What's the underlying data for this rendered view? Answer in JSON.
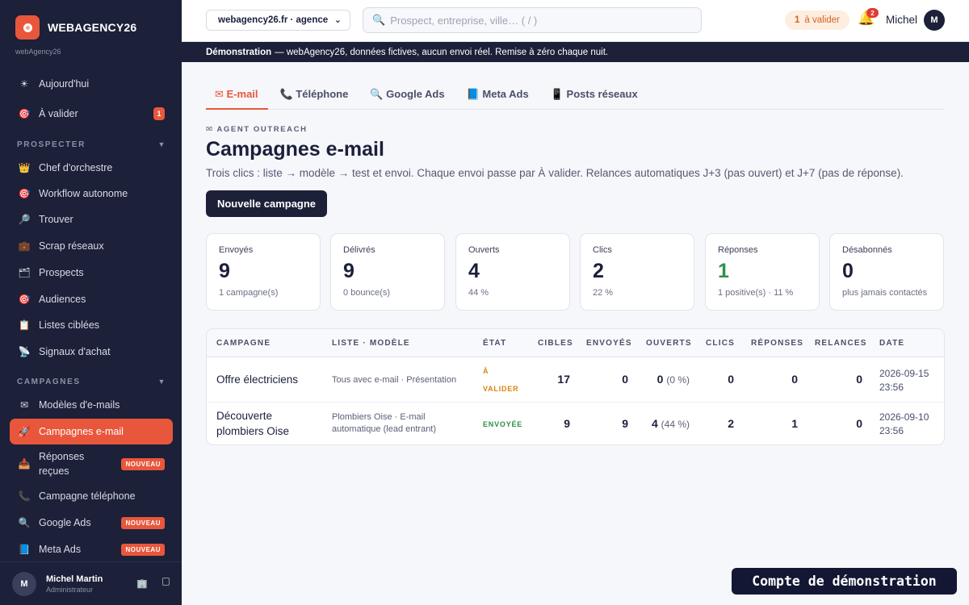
{
  "brand": {
    "name": "WEBAGENCY26",
    "sub": "webAgency26"
  },
  "sidebar": {
    "top_items": [
      {
        "label": "Aujourd'hui",
        "icon": "sun-icon"
      },
      {
        "label": "À valider",
        "icon": "target-icon",
        "badge": "1"
      }
    ],
    "sections": [
      {
        "title": "PROSPECTER",
        "items": [
          {
            "label": "Chef d'orchestre",
            "icon": "crown-icon"
          },
          {
            "label": "Workflow autonome",
            "icon": "target-icon"
          },
          {
            "label": "Trouver",
            "icon": "magnifier-icon"
          },
          {
            "label": "Scrap réseaux",
            "icon": "briefcase-icon"
          },
          {
            "label": "Prospects",
            "icon": "folder-icon"
          },
          {
            "label": "Audiences",
            "icon": "target-icon"
          },
          {
            "label": "Listes ciblées",
            "icon": "clipboard-icon"
          },
          {
            "label": "Signaux d'achat",
            "icon": "satellite-icon"
          }
        ]
      },
      {
        "title": "CAMPAGNES",
        "items": [
          {
            "label": "Modèles d'e-mails",
            "icon": "envelope-icon"
          },
          {
            "label": "Campagnes e-mail",
            "icon": "rocket-icon",
            "active": true
          },
          {
            "label": "Réponses reçues",
            "icon": "inbox-icon",
            "badge_new": "NOUVEAU"
          },
          {
            "label": "Campagne téléphone",
            "icon": "phone-icon"
          },
          {
            "label": "Google Ads",
            "icon": "magnifier-icon",
            "badge_new": "NOUVEAU"
          },
          {
            "label": "Meta Ads",
            "icon": "book-icon",
            "badge_new": "NOUVEAU"
          }
        ]
      }
    ],
    "user": {
      "initial": "M",
      "name": "Michel Martin",
      "role": "Administrateur"
    }
  },
  "topbar": {
    "agency": "webagency26.fr · agence",
    "search_placeholder": "Prospect, entreprise, ville…  ( / )",
    "validate_count": "1",
    "validate_label": "à valider",
    "notif_count": "2",
    "user_name": "Michel",
    "user_initial": "M"
  },
  "banner": {
    "bold": "Démonstration",
    "text": "— webAgency26, données fictives, aucun envoi réel. Remise à zéro chaque nuit."
  },
  "tabs": [
    {
      "label": "✉ E-mail",
      "active": true
    },
    {
      "label": "📞 Téléphone"
    },
    {
      "label": "🔍 Google Ads"
    },
    {
      "label": "📘 Meta Ads"
    },
    {
      "label": "📱 Posts réseaux"
    }
  ],
  "header": {
    "kicker": "✉ AGENT OUTREACH",
    "title": "Campagnes e-mail",
    "description": "Trois clics : liste → modèle → test et envoi. Chaque envoi passe par À valider. Relances automatiques J+3 (pas ouvert) et J+7 (pas de réponse).",
    "new_button": "Nouvelle campagne"
  },
  "stats": [
    {
      "label": "Envoyés",
      "value": "9",
      "sub": "1 campagne(s)"
    },
    {
      "label": "Délivrés",
      "value": "9",
      "sub": "0 bounce(s)"
    },
    {
      "label": "Ouverts",
      "value": "4",
      "sub": "44 %"
    },
    {
      "label": "Clics",
      "value": "2",
      "sub": "22 %"
    },
    {
      "label": "Réponses",
      "value": "1",
      "sub": "1 positive(s) · 11 %",
      "highlight": true
    },
    {
      "label": "Désabonnés",
      "value": "0",
      "sub": "plus jamais contactés"
    }
  ],
  "table": {
    "columns": [
      "CAMPAGNE",
      "LISTE · MODÈLE",
      "ÉTAT",
      "CIBLES",
      "ENVOYÉS",
      "OUVERTS",
      "CLICS",
      "RÉPONSES",
      "RELANCES",
      "DATE"
    ],
    "rows": [
      {
        "name": "Offre électriciens",
        "list": "Tous avec e-mail · Présentation",
        "state": "À VALIDER",
        "state_kind": "pending",
        "cibles": "17",
        "envoyes": "0",
        "ouverts": "0",
        "ouverts_pct": "(0 %)",
        "clics": "0",
        "reponses": "0",
        "relances": "0",
        "date": "2026-09-15 23:56"
      },
      {
        "name": "Découverte plombiers Oise",
        "list": "Plombiers Oise · E-mail automatique (lead entrant)",
        "state": "ENVOYÉE",
        "state_kind": "sent",
        "cibles": "9",
        "envoyes": "9",
        "ouverts": "4",
        "ouverts_pct": "(44 %)",
        "clics": "2",
        "reponses": "1",
        "relances": "0",
        "date": "2026-09-10 23:56"
      }
    ]
  },
  "demo_toast": "Compte de démonstration"
}
